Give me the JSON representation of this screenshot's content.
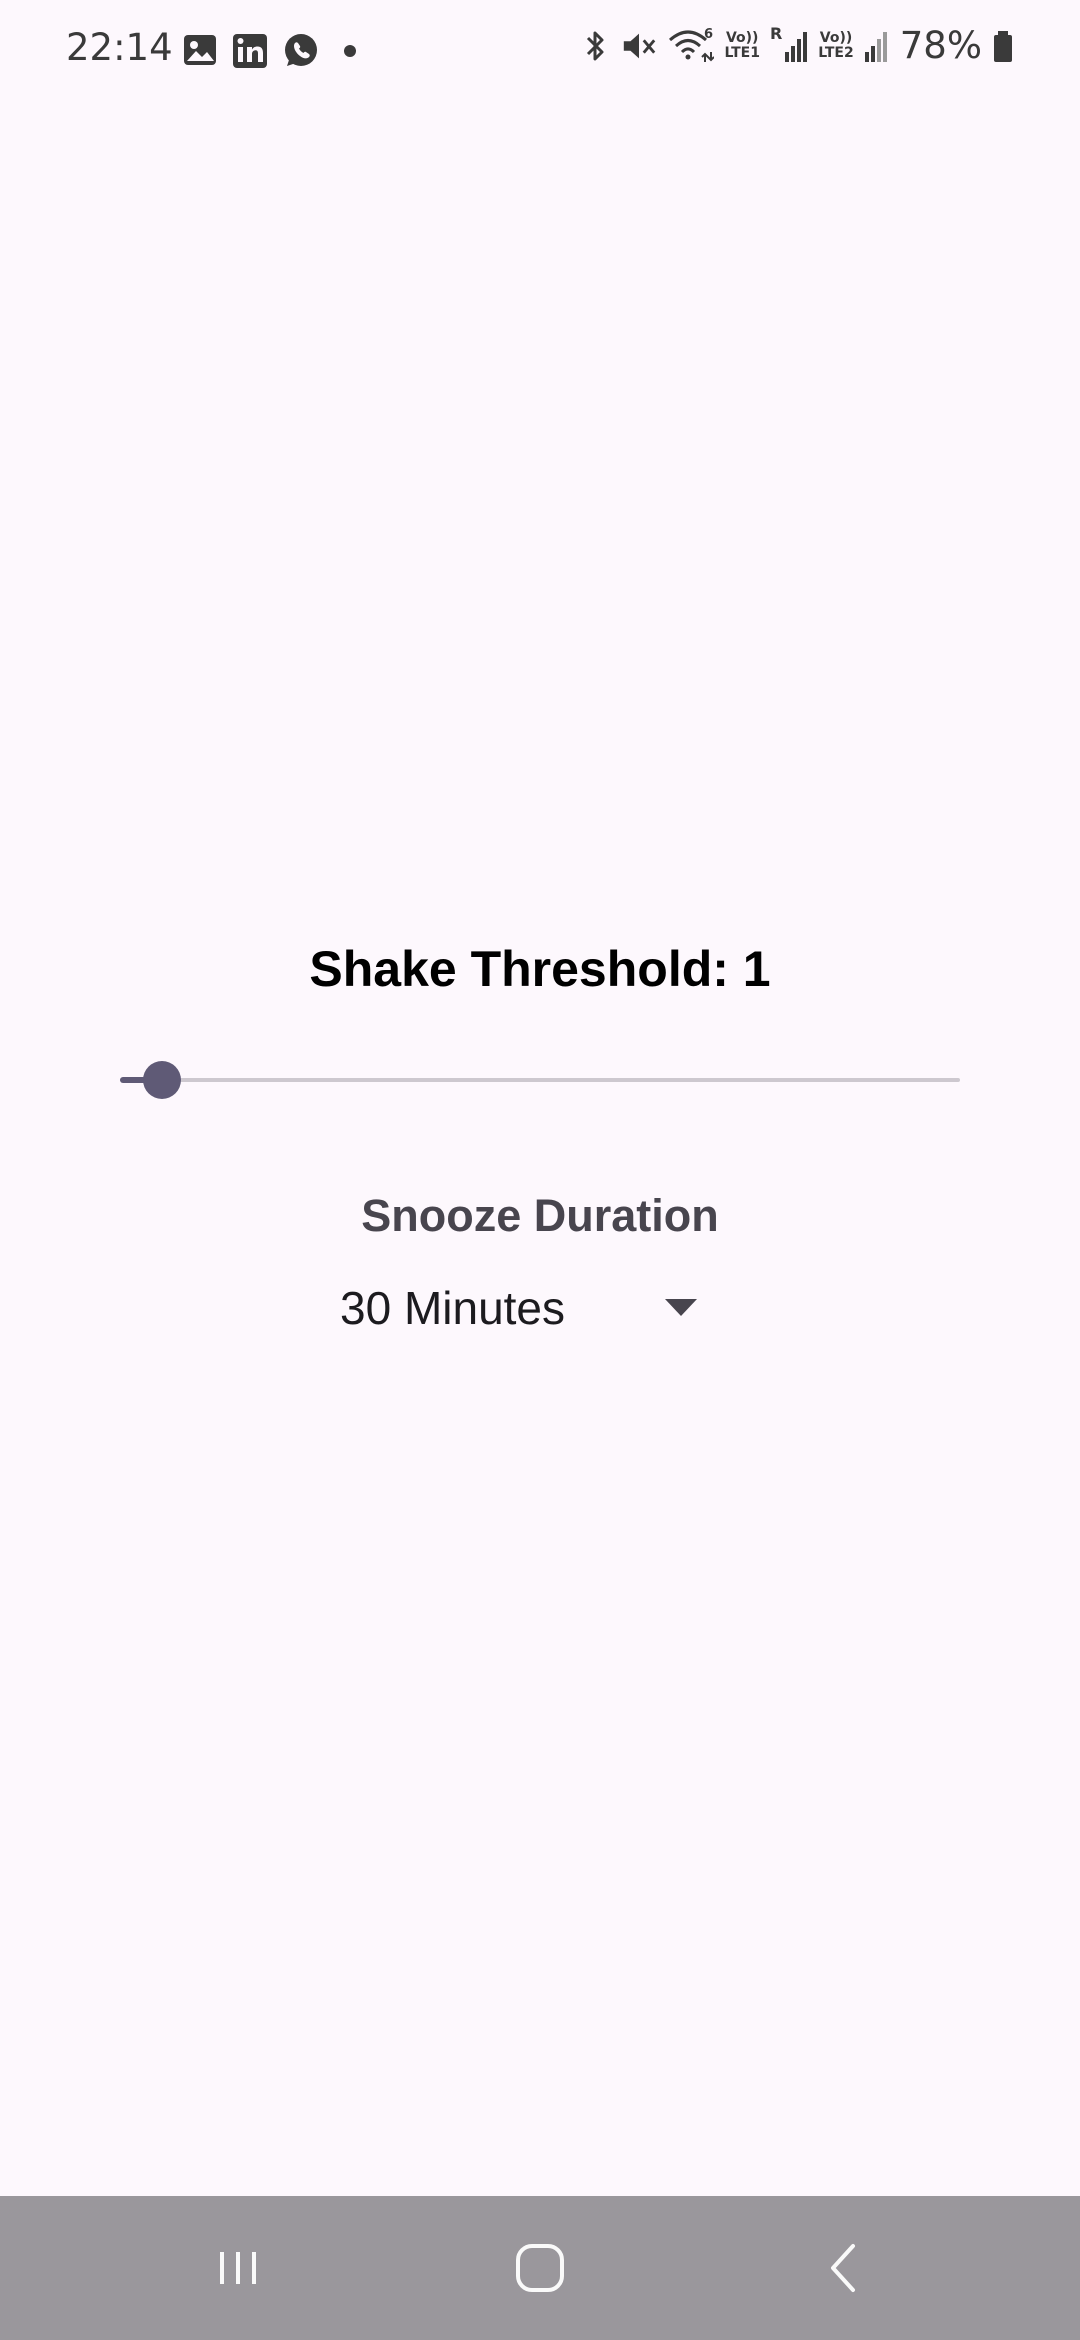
{
  "status_bar": {
    "time": "22:14",
    "battery_percent": "78%",
    "net1_top": "Vo))",
    "net1_bottom": "LTE1",
    "net2_top": "Vo))",
    "net2_bottom": "LTE2",
    "roaming": "R",
    "wifi_gen": "6",
    "left_icons": [
      "gallery-icon",
      "linkedin-icon",
      "whatsapp-icon",
      "dot-icon"
    ],
    "right_icons": [
      "bluetooth-icon",
      "mute-icon",
      "wifi-icon",
      "signal-icon",
      "battery-icon"
    ]
  },
  "shake": {
    "title": "Shake Threshold: 1",
    "slider_value": 1,
    "slider_min": 0,
    "slider_max": 20,
    "accent_color": "#5f5a76",
    "track_color": "#cdc8cf"
  },
  "snooze": {
    "label": "Snooze Duration",
    "selected": "30 Minutes"
  },
  "nav_bar": {
    "buttons": [
      "recent-apps-button",
      "home-button",
      "back-button"
    ],
    "background_color": "#9a979c"
  },
  "background_color": "#fdf8fd"
}
